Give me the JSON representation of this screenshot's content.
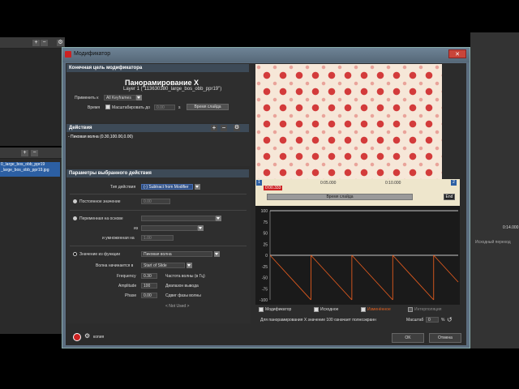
{
  "dialog": {
    "title": "Модификатор",
    "close": "✕"
  },
  "target": {
    "header": "Конечная цель модификатора",
    "title": "Панорамирование X",
    "layer": "Layer 1 (\"113630380_large_bos_obb_ppr19\")",
    "apply_label": "Применить к",
    "apply_value": "All Keyframes",
    "time_label": "Время",
    "scale_label": "Масштабировать до",
    "scale_value": "0.00",
    "scale_unit": "s",
    "slide_time_btn": "Время слайда"
  },
  "actions": {
    "header": "Действия",
    "item": "- Пиковая волна (0.30,100.00,0.00)"
  },
  "params": {
    "header": "Параметры выбранного действия",
    "type_label": "Тип действия",
    "type_value": "(-) Subtract from Modifier",
    "const_label": "Постоянное значение",
    "const_value": "0.00",
    "var_label": "Переменная на основе",
    "from_label": "из",
    "mult_label": "и умноженная на",
    "mult_value": "1.00",
    "func_label": "Значение из функции",
    "func_value": "Пиковая волна",
    "wave_start_label": "Волна начинается в",
    "wave_start_value": "Start of Slide",
    "freq_label": "Frequency",
    "freq_value": "0.30",
    "freq_desc": "Частота волны (в Гц)",
    "amp_label": "Amplitude",
    "amp_value": "100",
    "amp_desc": "Диапазон вывода",
    "phase_label": "Phase",
    "phase_value": "0.00",
    "phase_desc": "Сдвиг фазы волны",
    "not_used": "< Not Used >"
  },
  "timeline": {
    "marker1": "1",
    "marker2": "2",
    "t_mid": "0:05.000",
    "t_end": "0:10.000",
    "current": "0:00.333",
    "slide_time": "Время слайда",
    "end_btn": "End"
  },
  "graph": {
    "y_labels": [
      "100",
      "75",
      "50",
      "25",
      "0",
      "-25",
      "-50",
      "-75",
      "-100"
    ]
  },
  "legend": {
    "modifier": "Модификатор",
    "source": "Исходное",
    "modified": "Изменённое",
    "interp": "Интерполяция"
  },
  "status": {
    "text": "Для панорамирования X значение 100 означает полноэкранн",
    "zoom_label": "Масштаб",
    "zoom_value": "0",
    "zoom_unit": "%"
  },
  "footer": {
    "copy_label": "копия",
    "ok": "OK",
    "cancel": "Отмена"
  },
  "background": {
    "file1": "0_large_bos_obb_ppr19",
    "file2": "_large_bos_obb_ppr19.jpg",
    "right_time": "0:14.000",
    "right_label": "Исходный переход"
  }
}
